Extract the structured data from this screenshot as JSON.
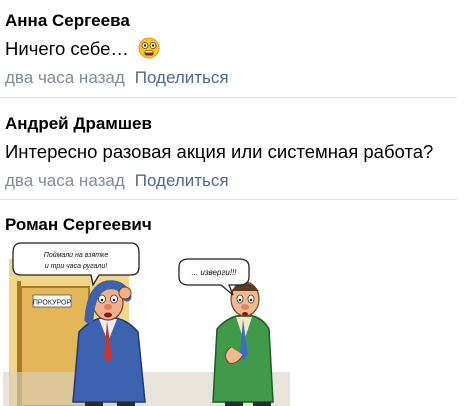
{
  "comments": [
    {
      "author": "Анна Сергеева",
      "text": "Ничего себе…",
      "emoji": "astonished-face-emoji",
      "time": "два часа назад",
      "share_label": "Поделиться"
    },
    {
      "author": "Андрей Драмшев",
      "text": "Интересно разовая акция или системная работа?",
      "time": "два часа назад",
      "share_label": "Поделиться"
    },
    {
      "author": "Роман Сергеевич",
      "image": {
        "door_sign": "ПРОКУРОР",
        "bubble_left_line1": "Поймали на взятке",
        "bubble_left_line2": "и три часа ругали!",
        "bubble_right": "... изверги!!!"
      }
    }
  ],
  "colors": {
    "meta": "#818c99",
    "link": "#4d6a8f",
    "divider": "#dfe2e6"
  }
}
